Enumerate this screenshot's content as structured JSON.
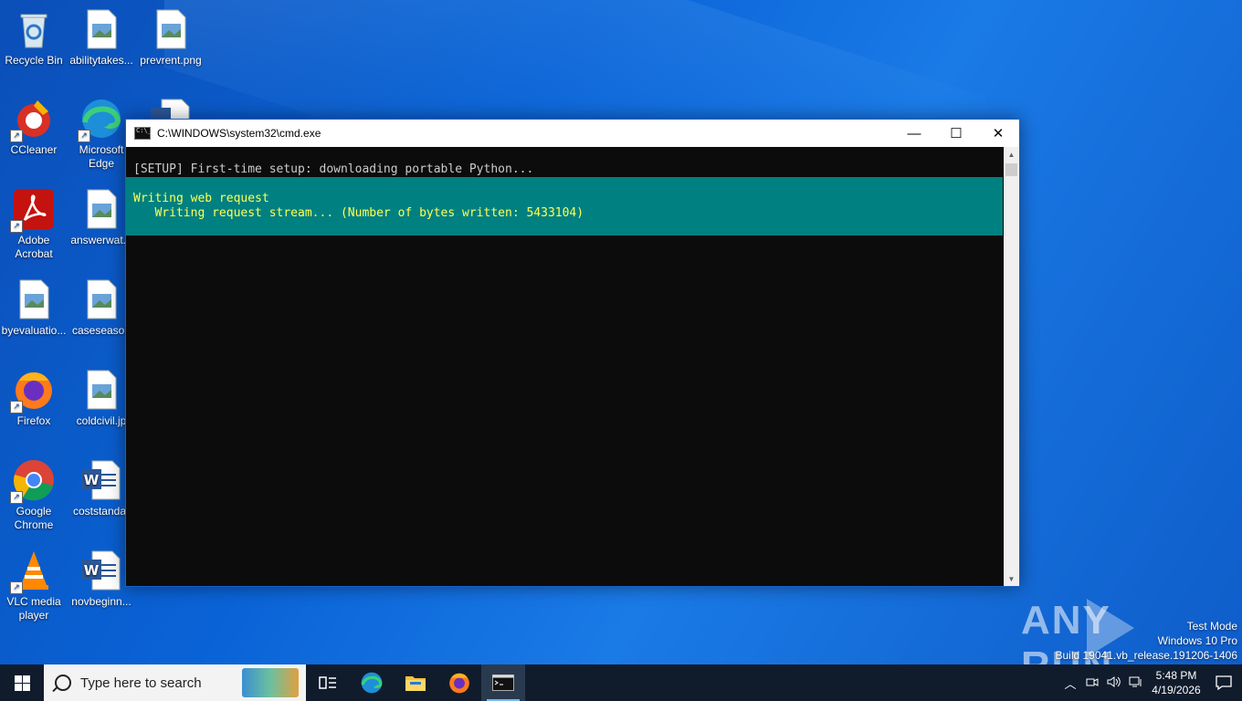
{
  "desktop": {
    "icons": [
      {
        "label": "Recycle Bin",
        "icon": "recycle-bin-icon"
      },
      {
        "label": "abilitytakes...",
        "icon": "image-file-icon"
      },
      {
        "label": "prevrent.png",
        "icon": "image-file-icon"
      },
      {
        "label": "CCleaner",
        "icon": "ccleaner-icon"
      },
      {
        "label": "Microsoft Edge",
        "icon": "edge-icon"
      },
      {
        "label": "Adobe Acrobat",
        "icon": "acrobat-icon"
      },
      {
        "label": "answerwat...",
        "icon": "image-file-icon"
      },
      {
        "label": "byevaluatio...",
        "icon": "image-file-icon"
      },
      {
        "label": "caseseason",
        "icon": "image-file-icon"
      },
      {
        "label": "Firefox",
        "icon": "firefox-icon"
      },
      {
        "label": "coldcivil.jp",
        "icon": "image-file-icon"
      },
      {
        "label": "Google Chrome",
        "icon": "chrome-icon"
      },
      {
        "label": "coststandar",
        "icon": "word-doc-icon"
      },
      {
        "label": "VLC media player",
        "icon": "vlc-icon"
      },
      {
        "label": "novbeginn...",
        "icon": "word-doc-icon"
      }
    ]
  },
  "cmd": {
    "title": "C:\\WINDOWS\\system32\\cmd.exe",
    "setup_line": "[SETUP] First-time setup: downloading portable Python...",
    "progress_title": "Writing web request",
    "progress_detail": "   Writing request stream... (Number of bytes written: 5433104)",
    "minimize": "—",
    "maximize": "☐",
    "close": "✕"
  },
  "watermark": {
    "text_left": "ANY",
    "text_right": "RUN"
  },
  "os_info": {
    "line1": "Test Mode",
    "line2": "Windows 10 Pro",
    "line3": "Build 19041.vb_release.191206-1406"
  },
  "taskbar": {
    "search_placeholder": "Type here to search",
    "time": "5:48 PM",
    "date": "4/19/2026"
  },
  "colors": {
    "console_bg": "#0c0c0c",
    "progress_bg": "#008080",
    "progress_text": "#ffff55",
    "taskbar_bg": "#101c2c"
  }
}
